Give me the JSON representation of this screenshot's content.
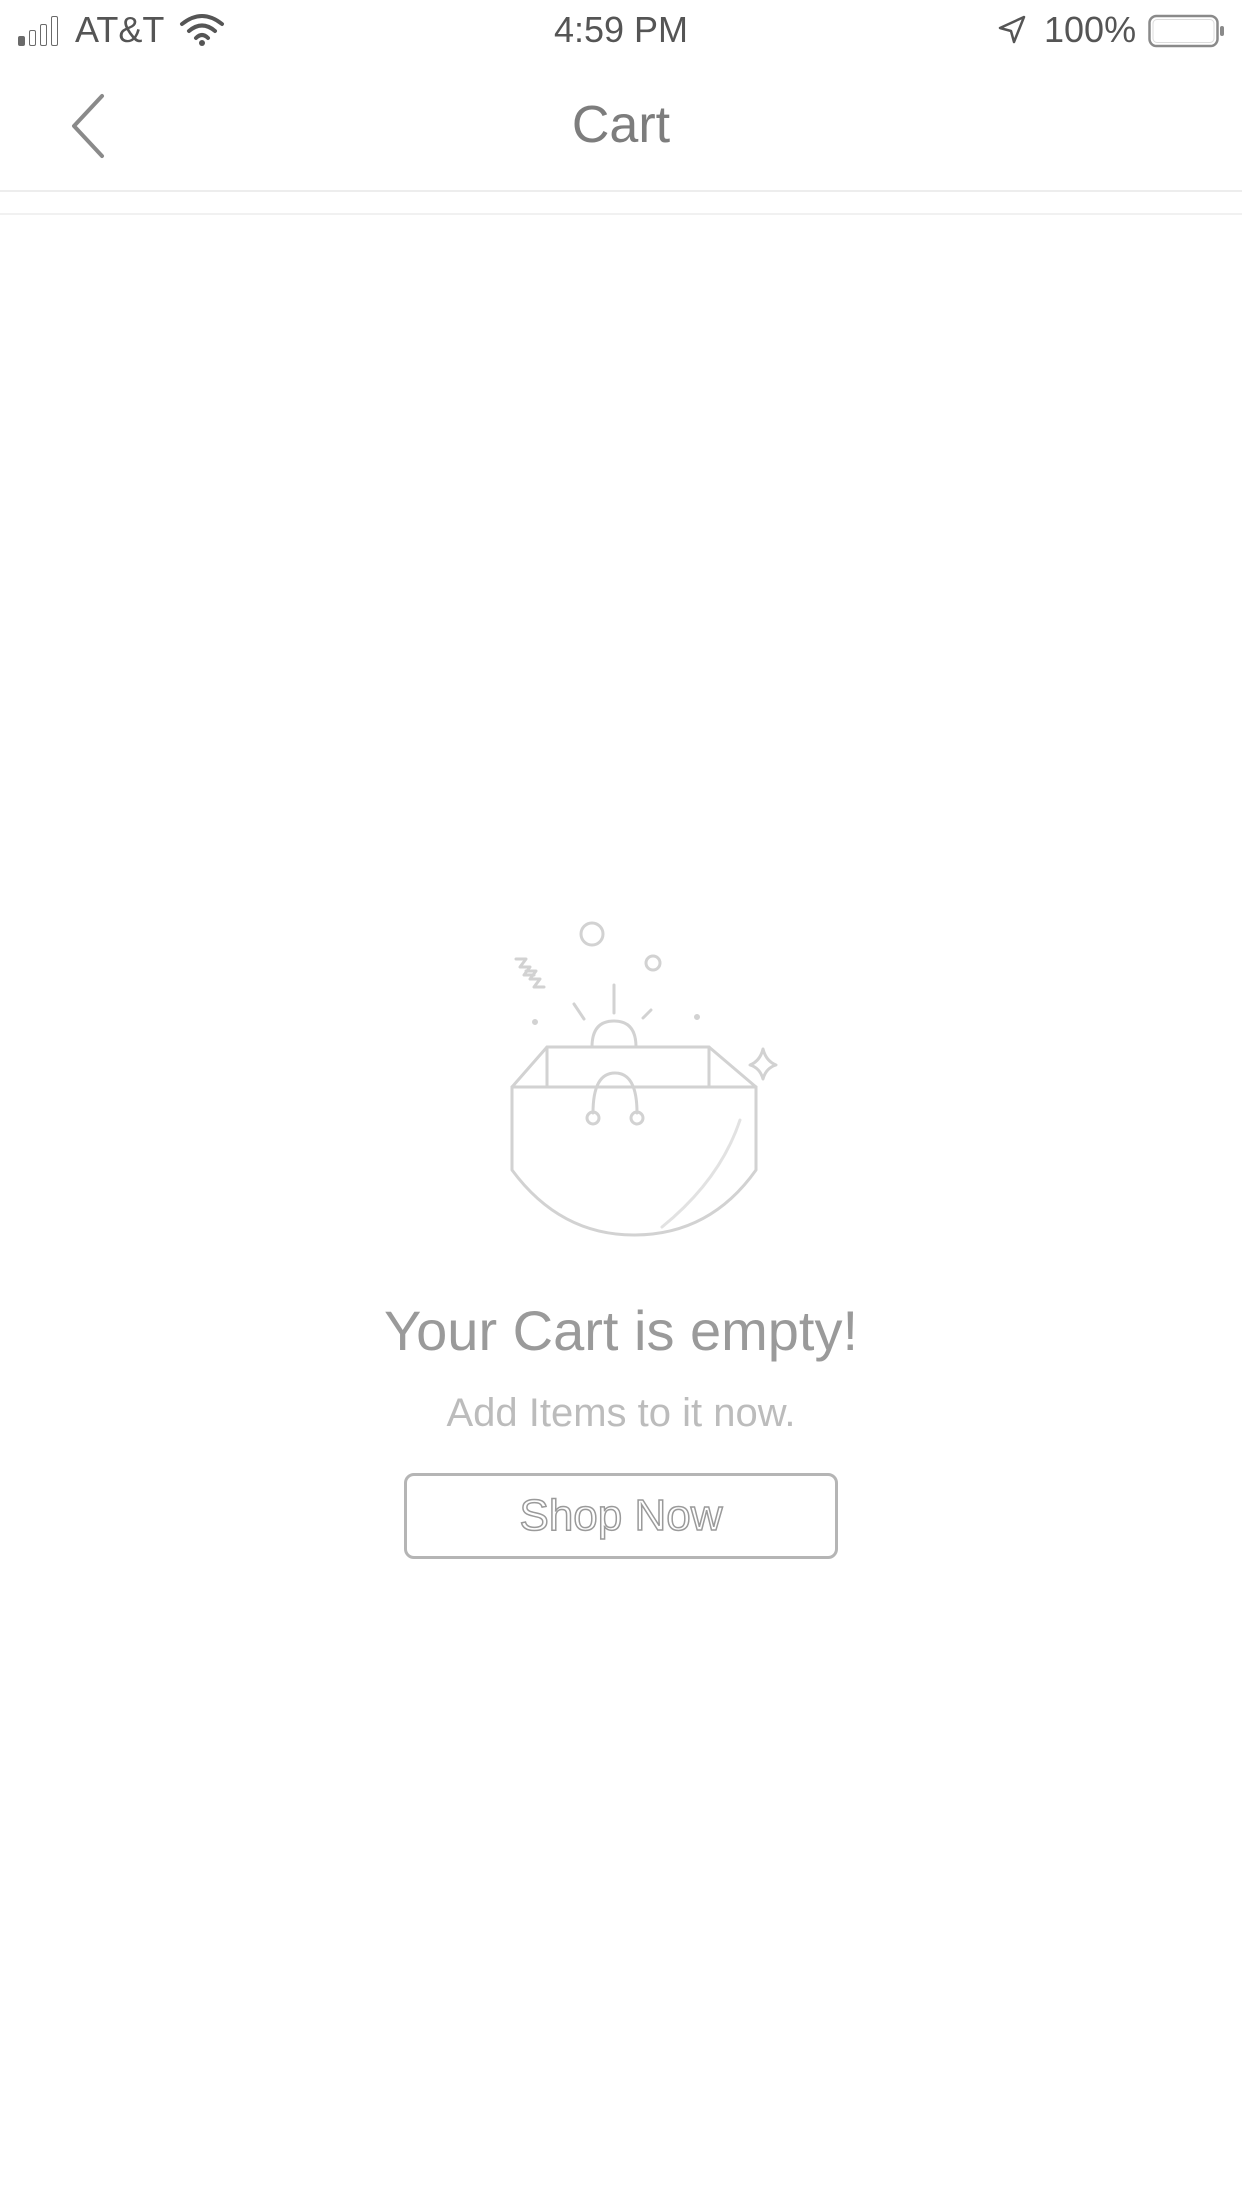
{
  "status_bar": {
    "carrier": "AT&T",
    "time": "4:59 PM",
    "battery_percent": "100%",
    "icons": [
      "signal-icon",
      "wifi-icon",
      "location-arrow-icon",
      "battery-icon"
    ]
  },
  "nav": {
    "title": "Cart",
    "back_icon": "chevron-left-icon"
  },
  "empty_state": {
    "illustration": "shopping-bag-icon",
    "title": "Your Cart is empty!",
    "subtitle": "Add Items to it now.",
    "button_label": "Shop Now"
  },
  "colors": {
    "text": "#8a8a8a",
    "illustration_stroke": "#d4d4d4",
    "button_border": "#b5b5b5",
    "background": "#ffffff"
  }
}
